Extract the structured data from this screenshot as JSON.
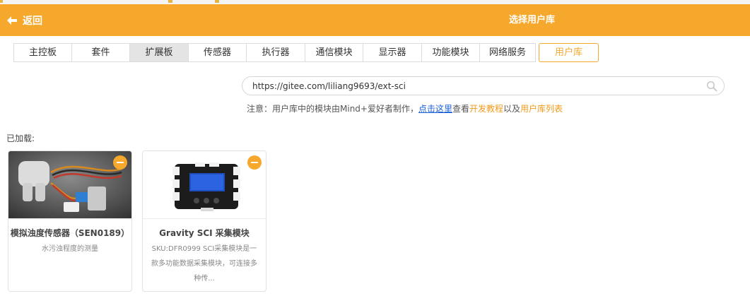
{
  "header": {
    "back_label": "返回",
    "title": "选择用户库"
  },
  "tabs": [
    {
      "label": "主控板"
    },
    {
      "label": "套件"
    },
    {
      "label": "扩展板"
    },
    {
      "label": "传感器"
    },
    {
      "label": "执行器"
    },
    {
      "label": "通信模块"
    },
    {
      "label": "显示器"
    },
    {
      "label": "功能模块"
    },
    {
      "label": "网络服务"
    },
    {
      "label": "用户库"
    }
  ],
  "search": {
    "value": "https://gitee.com/liliang9693/ext-sci"
  },
  "note": {
    "prefix": "注意：用户库中的模块由Mind+爱好者制作，",
    "click_here": "点击这里",
    "view": "查看",
    "dev_tutorial": "开发教程",
    "and": "以及",
    "user_lib_list": "用户库列表"
  },
  "loaded_label": "已加载:",
  "cards": [
    {
      "title": "模拟浊度传感器（SEN0189）",
      "desc": "水污浊程度的测量"
    },
    {
      "title": "Gravity SCI 采集模块",
      "desc": "SKU:DFR0999 SCI采集模块是一款多功能数据采集模块，可连接多种传..."
    }
  ],
  "colors": {
    "accent": "#f6a82c",
    "link": "#1a5fd8",
    "highlight": "#f29a1a"
  }
}
